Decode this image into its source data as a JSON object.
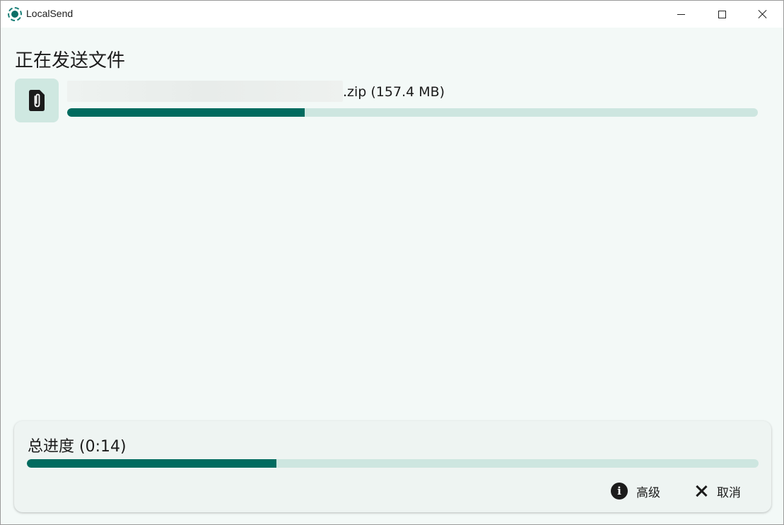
{
  "window": {
    "app_title": "LocalSend",
    "app_icon": "localsend-logo-icon"
  },
  "transfer": {
    "title": "正在发送文件",
    "file": {
      "icon": "file-attachment-icon",
      "name_suffix": ".zip (157.4 MB)",
      "progress": 0.344
    }
  },
  "total": {
    "label": "总进度 (0:14)",
    "progress": 0.341
  },
  "actions": {
    "advanced_label": "高级",
    "cancel_label": "取消"
  },
  "colors": {
    "accent": "#006b5f",
    "track": "#cde6e0",
    "thumb_bg": "#cfe8e1"
  }
}
